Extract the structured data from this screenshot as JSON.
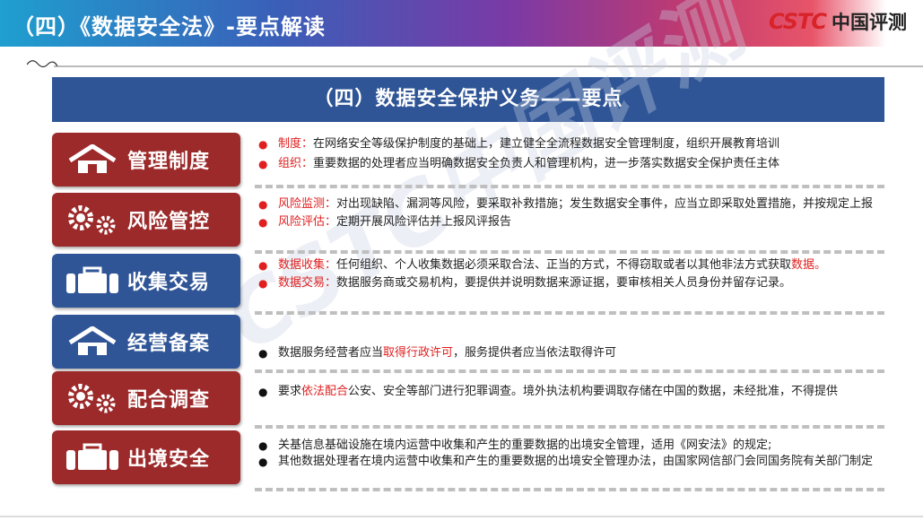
{
  "header": {
    "title": "（四）《数据安全法》-要点解读"
  },
  "logo": {
    "mark": "CSTC",
    "text": "中国评测"
  },
  "banner": {
    "title": "（四）数据安全保护义务——要点"
  },
  "watermark": "CSTC中国评测",
  "rows": [
    {
      "label": "管理制度",
      "icon": "house-icon",
      "color": "#9c2a2a",
      "items": [
        {
          "kw": "制度：",
          "text": "在网络安全等级保护制度的基础上，建立健全全流程数据安全管理制度，组织开展教育培训"
        },
        {
          "kw": "组织：",
          "text": "重要数据的处理者应当明确数据安全负责人和管理机构，进一步落实数据安全保护责任主体"
        }
      ]
    },
    {
      "label": "风险管控",
      "icon": "gears-icon",
      "color": "#9c2a2a",
      "items": [
        {
          "kw": "风险监测：",
          "text": "对出现缺陷、漏洞等风险，要采取补救措施；发生数据安全事件，应当立即采取处置措施，并按规定上报"
        },
        {
          "kw": "风险评估：",
          "text": "定期开展风险评估并上报风评报告"
        }
      ]
    },
    {
      "label": "收集交易",
      "icon": "briefcase-icon",
      "color": "#2f5597",
      "items": [
        {
          "kw": "数据收集：",
          "text": "任何组织、个人收集数据必须采取合法、正当的方式，不得窃取或者以其他非法方式获取",
          "tail": "数据。"
        },
        {
          "kw": "数据交易：",
          "text": "数据服务商或交易机构，要提供并说明数据来源证据，要审核相关人员身份并留存记录。"
        }
      ]
    },
    {
      "label": "经营备案",
      "icon": "house-icon",
      "color": "#2f5597",
      "items": [
        {
          "pre": "数据服务经营者应当",
          "kw": "取得行政许可",
          "text": "，服务提供者应当依法取得许可"
        }
      ]
    },
    {
      "label": "配合调查",
      "icon": "gears-icon",
      "color": "#9c2a2a",
      "items": [
        {
          "pre": "要求",
          "kw": "依法配合",
          "text": "公安、安全等部门进行犯罪调查。境外执法机构要调取存储在中国的数据，未经批准，不得提供"
        }
      ]
    },
    {
      "label": "出境安全",
      "icon": "briefcase-icon",
      "color": "#9c2a2a",
      "items": [
        {
          "text": "关基信息基础设施在境内运营中收集和产生的重要数据的出境安全管理，适用《网安法》的规定;"
        },
        {
          "text": "其他数据处理者在境内运营中收集和产生的重要数据的出境安全管理办法，由国家网信部门会同国务院有关部门制定"
        }
      ]
    }
  ]
}
